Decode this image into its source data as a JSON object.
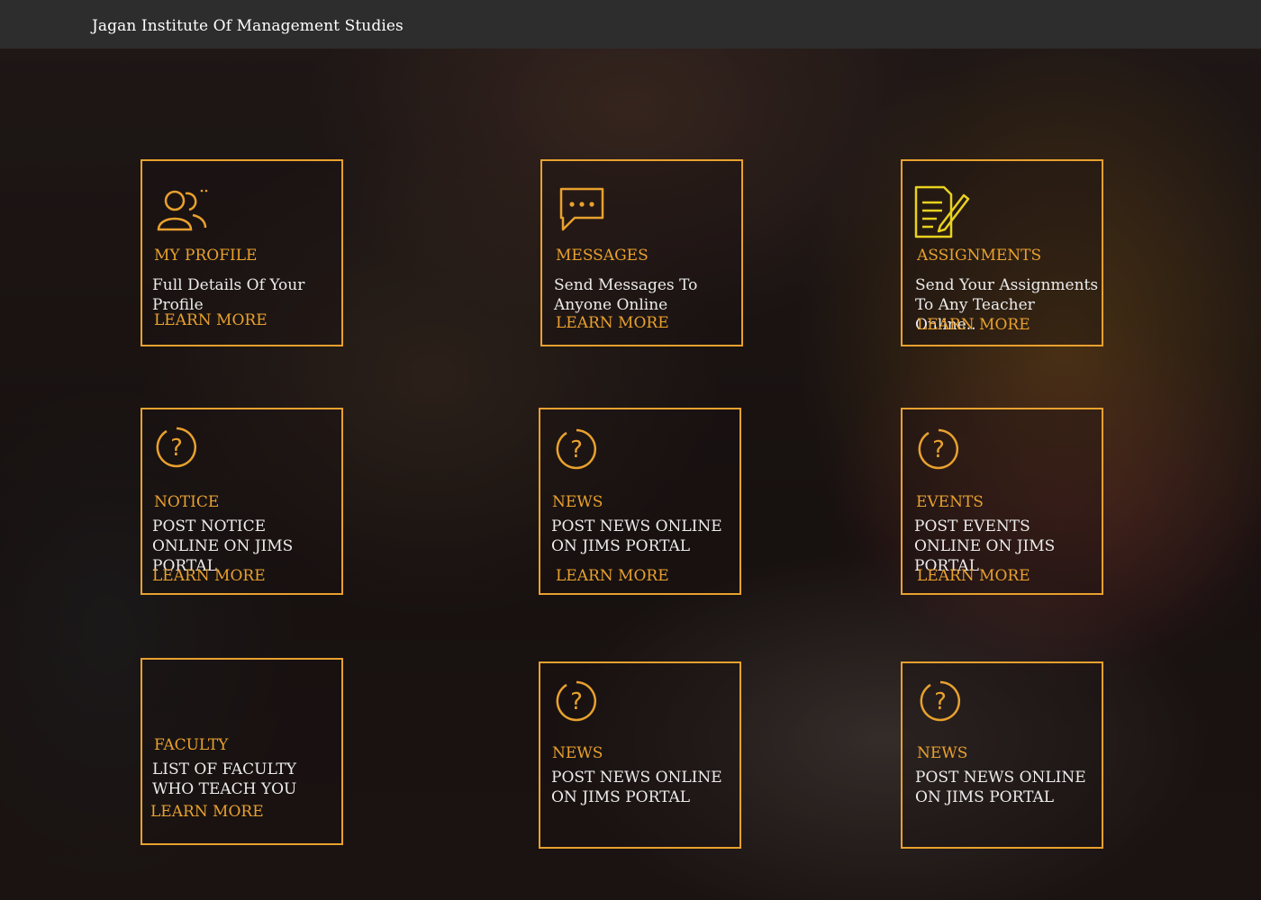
{
  "header": {
    "title": "Jagan Institute Of Management Studies"
  },
  "colors": {
    "accent": "#e9a12e",
    "topbar": "#2e2d2d",
    "text": "#ececec"
  },
  "cards": [
    {
      "icon": "users-icon",
      "title": "MY PROFILE",
      "desc": "Full Details Of Your Profile",
      "more": "LEARN MORE"
    },
    {
      "icon": "chat-bubble-icon",
      "title": "MESSAGES",
      "desc": "Send Messages To Anyone Online",
      "more": "LEARN MORE"
    },
    {
      "icon": "document-edit-icon",
      "title": "ASSIGNMENTS",
      "desc": "Send Your Assignments To Any Teacher Online..",
      "more": "LEARN MORE"
    },
    {
      "icon": "question-circle-icon",
      "title": "NOTICE",
      "desc": "POST NOTICE ONLINE ON JIMS PORTAL",
      "more": "LEARN MORE"
    },
    {
      "icon": "question-circle-icon",
      "title": "NEWS",
      "desc": "POST NEWS ONLINE ON JIMS PORTAL",
      "more": "LEARN MORE"
    },
    {
      "icon": "question-circle-icon",
      "title": "EVENTS",
      "desc": "POST EVENTS ONLINE ON JIMS PORTAL",
      "more": "LEARN MORE"
    },
    {
      "icon": "",
      "title": "FACULTY",
      "desc": "LIST OF FACULTY WHO TEACH YOU",
      "more": "LEARN MORE"
    },
    {
      "icon": "question-circle-icon",
      "title": "NEWS",
      "desc": "POST NEWS ONLINE ON JIMS PORTAL",
      "more": ""
    },
    {
      "icon": "question-circle-icon",
      "title": "NEWS",
      "desc": "POST NEWS ONLINE ON JIMS PORTAL",
      "more": ""
    }
  ]
}
